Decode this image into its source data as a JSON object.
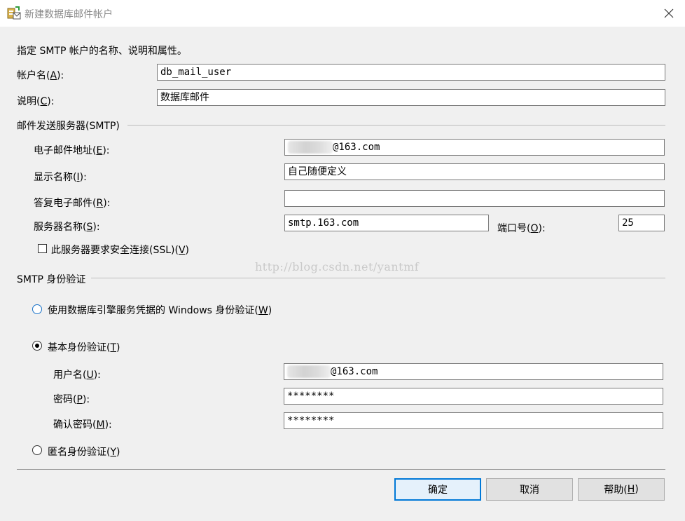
{
  "window": {
    "title": "新建数据库邮件帐户",
    "icon": "database-mail-icon"
  },
  "intro": "指定 SMTP 帐户的名称、说明和属性。",
  "account_name": {
    "label_pre": "帐户名(",
    "accel": "A",
    "label_post": "):",
    "value": "db_mail_user"
  },
  "description": {
    "label_pre": "说明(",
    "accel": "C",
    "label_post": "):",
    "value": "数据库邮件"
  },
  "smtp_group": {
    "title": "邮件发送服务器(SMTP)",
    "email": {
      "label_pre": "电子邮件地址(",
      "accel": "E",
      "label_post": "):",
      "value_suffix": "@163.com"
    },
    "display_name": {
      "label_pre": "显示名称(",
      "accel": "I",
      "label_post": "):",
      "value": "自己随便定义"
    },
    "reply_email": {
      "label_pre": "答复电子邮件(",
      "accel": "R",
      "label_post": "):",
      "value": ""
    },
    "server_name": {
      "label_pre": "服务器名称(",
      "accel": "S",
      "label_post": "):",
      "value": "smtp.163.com"
    },
    "port": {
      "label_pre": "端口号(",
      "accel": "O",
      "label_post": "):",
      "value": "25"
    },
    "ssl": {
      "label_pre": "此服务器要求安全连接(SSL)(",
      "accel": "V",
      "label_post": ")",
      "checked": false
    }
  },
  "watermark": "http://blog.csdn.net/yantmf",
  "auth_group": {
    "title": "SMTP 身份验证",
    "windows_auth": {
      "label_pre": "使用数据库引擎服务凭据的 Windows 身份验证(",
      "accel": "W",
      "label_post": ")",
      "selected": false
    },
    "basic_auth": {
      "label_pre": "基本身份验证(",
      "accel": "T",
      "label_post": ")",
      "selected": true
    },
    "username": {
      "label_pre": "用户名(",
      "accel": "U",
      "label_post": "):",
      "value_suffix": "@163.com"
    },
    "password": {
      "label_pre": "密码(",
      "accel": "P",
      "label_post": "):",
      "value": "********"
    },
    "confirm_password": {
      "label_pre": "确认密码(",
      "accel": "M",
      "label_post": "):",
      "value": "********"
    },
    "anonymous_auth": {
      "label_pre": "匿名身份验证(",
      "accel": "Y",
      "label_post": ")",
      "selected": false
    }
  },
  "buttons": {
    "ok": "确定",
    "cancel": "取消",
    "help_pre": "帮助(",
    "help_accel": "H",
    "help_post": ")"
  },
  "colors": {
    "accent": "#0078d7",
    "radio_focus": "#1a73c8",
    "background": "#f0f0f0"
  }
}
